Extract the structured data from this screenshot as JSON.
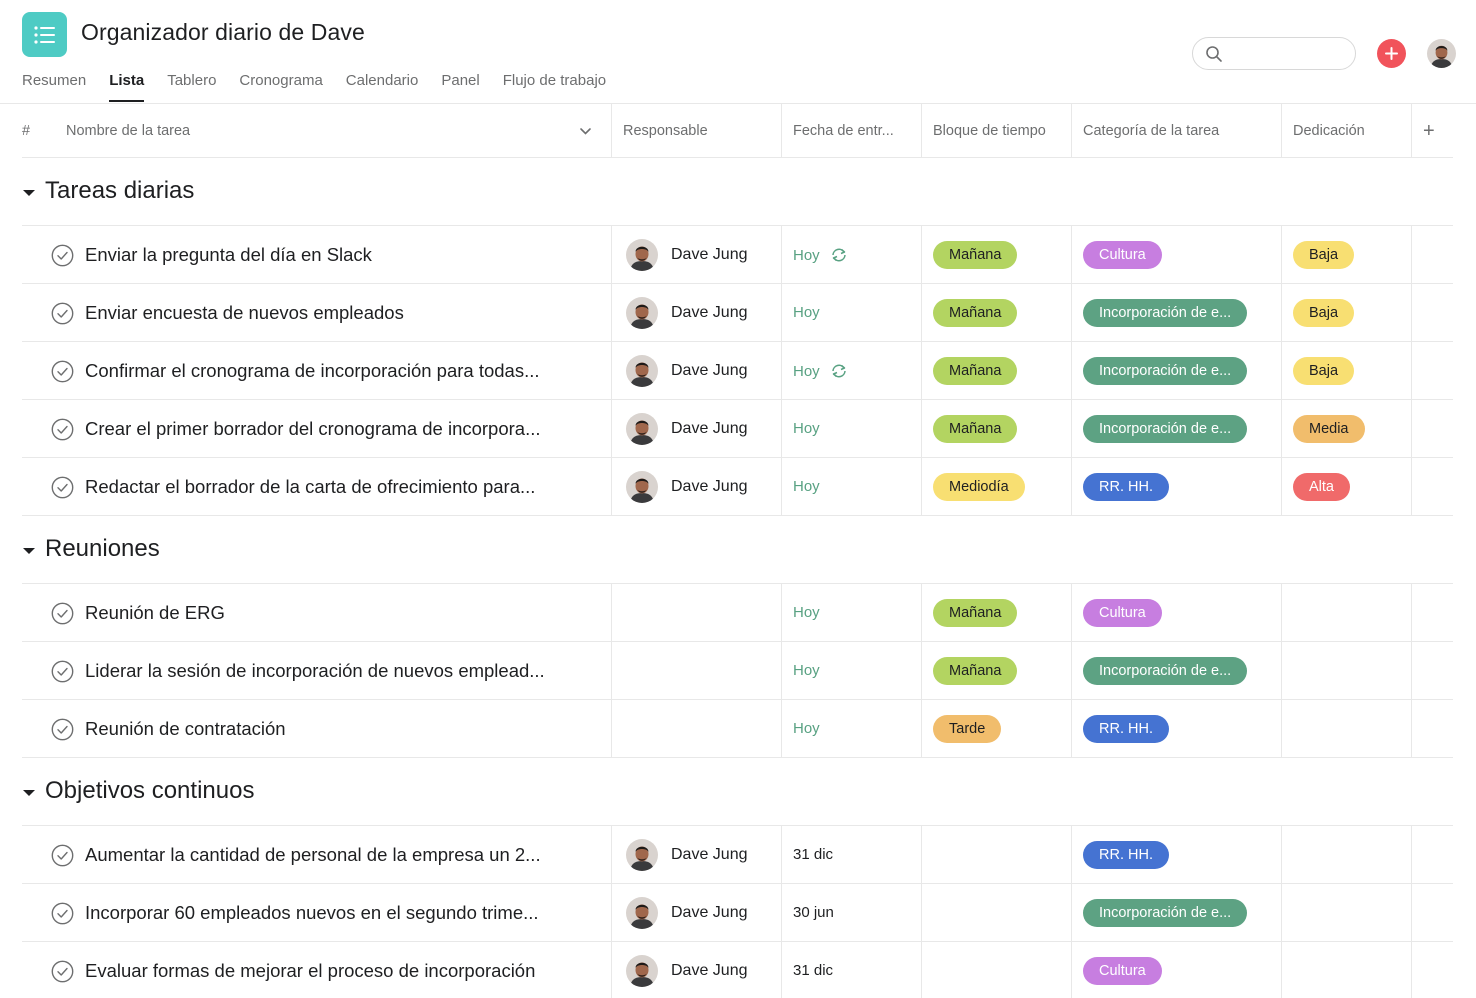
{
  "app": {
    "title": "Organizador diario de Dave",
    "icon": "list-icon",
    "accent": "#4ecbc4"
  },
  "tabs": [
    {
      "label": "Resumen",
      "active": false
    },
    {
      "label": "Lista",
      "active": true
    },
    {
      "label": "Tablero",
      "active": false
    },
    {
      "label": "Cronograma",
      "active": false
    },
    {
      "label": "Calendario",
      "active": false
    },
    {
      "label": "Panel",
      "active": false
    },
    {
      "label": "Flujo de trabajo",
      "active": false
    }
  ],
  "search": {
    "placeholder": "",
    "value": ""
  },
  "columns": {
    "hash": "#",
    "name": "Nombre de la tarea",
    "assignee": "Responsable",
    "due": "Fecha de entr...",
    "timeblock": "Bloque de tiempo",
    "category": "Categoría de la tarea",
    "effort": "Dedicación",
    "add": "+"
  },
  "colors": {
    "today_text": "#58a182",
    "add_button": "#f1535b",
    "manana": "#b3d461",
    "mediodia": "#f8df72",
    "tarde": "#f1bd6c",
    "cultura": "#c77ee0",
    "incorporacion": "#5da283",
    "rrhh": "#4573d2",
    "baja": "#f8df72",
    "media": "#f1bd6c",
    "alta": "#f06a6a"
  },
  "sections": [
    {
      "title": "Tareas diarias",
      "rows": [
        {
          "task": "Enviar la pregunta del día en Slack",
          "assignee": "Dave Jung",
          "date": "Hoy",
          "date_style": "today",
          "repeat": true,
          "timeblock": "Mañana",
          "timeblock_color": "manana",
          "category": "Cultura",
          "category_color": "cultura",
          "effort": "Baja",
          "effort_color": "baja"
        },
        {
          "task": "Enviar encuesta de nuevos empleados",
          "assignee": "Dave Jung",
          "date": "Hoy",
          "date_style": "today",
          "repeat": false,
          "timeblock": "Mañana",
          "timeblock_color": "manana",
          "category": "Incorporación de e...",
          "category_color": "incorporacion",
          "effort": "Baja",
          "effort_color": "baja"
        },
        {
          "task": "Confirmar el cronograma de incorporación para todas...",
          "assignee": "Dave Jung",
          "date": "Hoy",
          "date_style": "today",
          "repeat": true,
          "timeblock": "Mañana",
          "timeblock_color": "manana",
          "category": "Incorporación de e...",
          "category_color": "incorporacion",
          "effort": "Baja",
          "effort_color": "baja"
        },
        {
          "task": "Crear el primer borrador del cronograma de incorpora...",
          "assignee": "Dave Jung",
          "date": "Hoy",
          "date_style": "today",
          "repeat": false,
          "timeblock": "Mañana",
          "timeblock_color": "manana",
          "category": "Incorporación de e...",
          "category_color": "incorporacion",
          "effort": "Media",
          "effort_color": "media"
        },
        {
          "task": "Redactar el borrador de la carta de ofrecimiento para...",
          "assignee": "Dave Jung",
          "date": "Hoy",
          "date_style": "today",
          "repeat": false,
          "timeblock": "Mediodía",
          "timeblock_color": "mediodia",
          "category": "RR. HH.",
          "category_color": "rrhh",
          "effort": "Alta",
          "effort_color": "alta"
        }
      ]
    },
    {
      "title": "Reuniones",
      "rows": [
        {
          "task": "Reunión de ERG",
          "assignee": "",
          "date": "Hoy",
          "date_style": "today",
          "repeat": false,
          "timeblock": "Mañana",
          "timeblock_color": "manana",
          "category": "Cultura",
          "category_color": "cultura",
          "effort": "",
          "effort_color": ""
        },
        {
          "task": "Liderar la sesión de incorporación de nuevos emplead...",
          "assignee": "",
          "date": "Hoy",
          "date_style": "today",
          "repeat": false,
          "timeblock": "Mañana",
          "timeblock_color": "manana",
          "category": "Incorporación de e...",
          "category_color": "incorporacion",
          "effort": "",
          "effort_color": ""
        },
        {
          "task": "Reunión de contratación",
          "assignee": "",
          "date": "Hoy",
          "date_style": "today",
          "repeat": false,
          "timeblock": "Tarde",
          "timeblock_color": "tarde",
          "category": "RR. HH.",
          "category_color": "rrhh",
          "effort": "",
          "effort_color": ""
        }
      ]
    },
    {
      "title": "Objetivos continuos",
      "rows": [
        {
          "task": "Aumentar la cantidad de personal de la empresa un 2...",
          "assignee": "Dave Jung",
          "date": "31 dic",
          "date_style": "normal",
          "repeat": false,
          "timeblock": "",
          "timeblock_color": "",
          "category": "RR. HH.",
          "category_color": "rrhh",
          "effort": "",
          "effort_color": ""
        },
        {
          "task": "Incorporar 60 empleados nuevos en el segundo trime...",
          "assignee": "Dave Jung",
          "date": "30 jun",
          "date_style": "normal",
          "repeat": false,
          "timeblock": "",
          "timeblock_color": "",
          "category": "Incorporación de e...",
          "category_color": "incorporacion",
          "effort": "",
          "effort_color": ""
        },
        {
          "task": "Evaluar formas de mejorar el proceso de incorporación",
          "assignee": "Dave Jung",
          "date": "31 dic",
          "date_style": "normal",
          "repeat": false,
          "timeblock": "",
          "timeblock_color": "",
          "category": "Cultura",
          "category_color": "cultura",
          "effort": "",
          "effort_color": ""
        }
      ]
    }
  ]
}
